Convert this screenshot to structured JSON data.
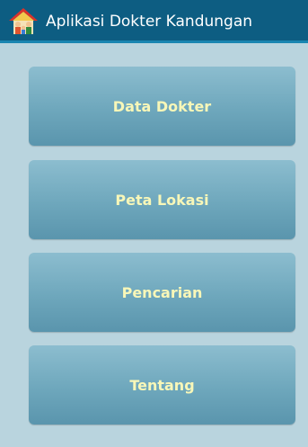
{
  "app": {
    "title": "Aplikasi Dokter Kandungan",
    "icon": "house-family-icon"
  },
  "menu": {
    "items": [
      {
        "label": "Data Dokter"
      },
      {
        "label": "Peta Lokasi"
      },
      {
        "label": "Pencarian"
      },
      {
        "label": "Tentang"
      }
    ]
  },
  "colors": {
    "action_bar": "#0d5d82",
    "background": "#b9d4de",
    "button": "#7db2c6",
    "button_text": "#f8f7b8"
  }
}
